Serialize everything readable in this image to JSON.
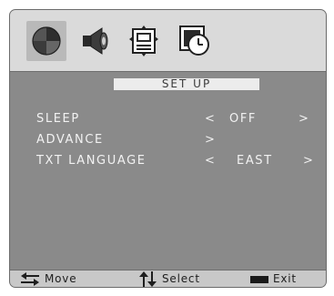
{
  "menu": {
    "title": "SET UP",
    "icons": [
      {
        "name": "picture-icon",
        "selected": true
      },
      {
        "name": "sound-icon",
        "selected": false
      },
      {
        "name": "setup-icon",
        "selected": false
      },
      {
        "name": "time-icon",
        "selected": false
      }
    ],
    "rows": [
      {
        "label": "SLEEP",
        "left_arrow": "<",
        "value": "OFF",
        "right_arrow": ">"
      },
      {
        "label": "ADVANCE",
        "left_arrow": ">",
        "value": "",
        "right_arrow": ""
      },
      {
        "label": "TXT LANGUAGE",
        "left_arrow": "<",
        "value": "EAST",
        "right_arrow": ">"
      }
    ]
  },
  "help": {
    "move": "Move",
    "select": "Select",
    "exit": "Exit"
  },
  "colors": {
    "panel": "#8a8a8a",
    "icon_bar": "#dadada",
    "title_bar": "#ececec",
    "help_bar": "#c8c8c8",
    "menu_text": "#f2f2f2"
  }
}
